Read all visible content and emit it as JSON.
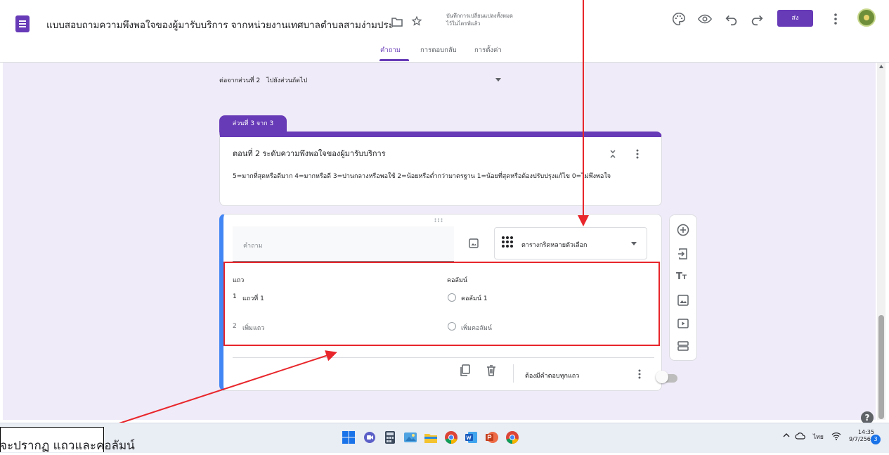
{
  "header": {
    "doc_title": "แบบสอบถามความพึงพอใจของผู้มารับบริการ จากหน่วยงานเทศบาลตำบลสามง่ามประ",
    "save_status": "บันทึกการเปลี่ยนแปลงทั้งหมด\nไว้ในไดรฟ์แล้ว",
    "send_label": "ส่ง",
    "tabs": [
      "คำถาม",
      "การตอบกลับ",
      "การตั้งค่า"
    ],
    "active_tab": "คำถาม"
  },
  "section_nav": {
    "after_label": "ต่อจากส่วนที่ 2",
    "after_value": "ไปยังส่วนถัดไป"
  },
  "section": {
    "badge": "ส่วนที่ 3 จาก 3",
    "title": "ตอนที่ 2  ระดับความพึงพอใจของผู้มารับบริการ",
    "description": "5=มากที่สุดหรือดีมาก 4=มากหรือดี 3=ปานกลางหรือพอใช้ 2=น้อยหรือต่ำกว่ามาตรฐาน 1=น้อยที่สุดหรือต้องปรับปรุงแก้ไข 0=ไม่พึงพอใจ"
  },
  "question": {
    "placeholder": "คำถาม",
    "type": "ตารางกริดหลายตัวเลือก",
    "rows_header": "แถว",
    "cols_header": "คอลัมน์",
    "rows": [
      {
        "num": "1",
        "label": "แถวที่ 1"
      },
      {
        "num": "2",
        "label": "เพิ่มแถว"
      }
    ],
    "columns": [
      "คอลัมน์ 1",
      "เพิ่มคอลัมน์"
    ],
    "required_label": "ต้องมีคำตอบทุกแถว"
  },
  "taskbar": {
    "lang": "ไทย",
    "time": "14:35",
    "date": "9/7/2565",
    "notification_count": "3"
  },
  "callout": {
    "text": "จะปรากฏ แถวและคอลัมน์"
  },
  "colors": {
    "accent": "#673ab7",
    "question_border": "#4285f4",
    "annotation": "#e8262b",
    "background": "#f0ebf8"
  }
}
